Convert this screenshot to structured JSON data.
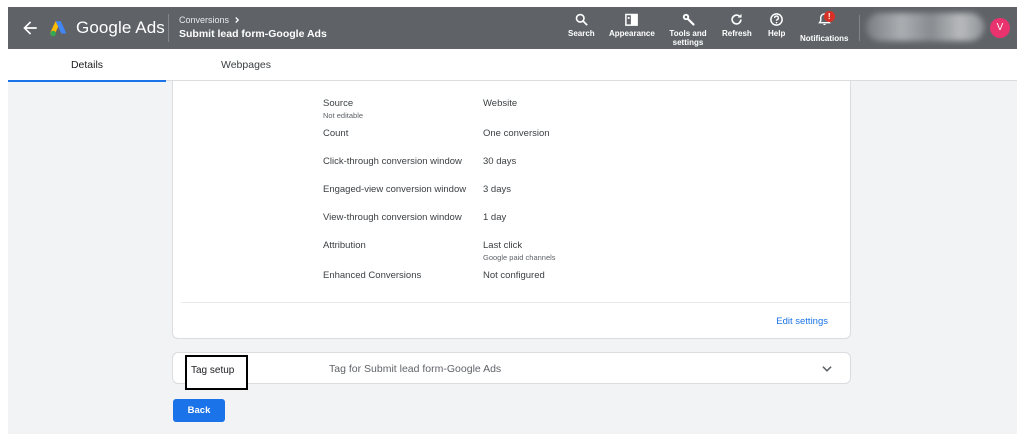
{
  "header": {
    "brand": "Google Ads",
    "breadcrumb": "Conversions",
    "title": "Submit lead form-Google Ads",
    "avatar_initial": "V",
    "tools": [
      {
        "label": "Search",
        "icon": "search-icon"
      },
      {
        "label": "Appearance",
        "icon": "appearance-icon"
      },
      {
        "label": "Tools and settings",
        "icon": "wrench-icon"
      },
      {
        "label": "Refresh",
        "icon": "refresh-icon"
      },
      {
        "label": "Help",
        "icon": "help-icon"
      },
      {
        "label": "Notifications",
        "icon": "bell-icon",
        "badge": "!"
      }
    ]
  },
  "tabs": [
    {
      "label": "Details",
      "active": true
    },
    {
      "label": "Webpages",
      "active": false
    }
  ],
  "settings": {
    "rows": [
      {
        "label": "Source",
        "sublabel": "Not editable",
        "value": "Website"
      },
      {
        "label": "Count",
        "value": "One conversion"
      },
      {
        "label": "Click-through conversion window",
        "value": "30 days"
      },
      {
        "label": "Engaged-view conversion window",
        "value": "3 days"
      },
      {
        "label": "View-through conversion window",
        "value": "1 day"
      },
      {
        "label": "Attribution",
        "value": "Last click",
        "value_sub": "Google paid channels"
      },
      {
        "label": "Enhanced Conversions",
        "value": "Not configured"
      }
    ],
    "edit_label": "Edit settings"
  },
  "tag_setup": {
    "label": "Tag setup",
    "description": "Tag for Submit lead form-Google Ads"
  },
  "back_label": "Back",
  "colors": {
    "topbar": "#5f6368",
    "accent": "#1a73e8",
    "avatar": "#e8336e",
    "badge": "#d93025"
  }
}
